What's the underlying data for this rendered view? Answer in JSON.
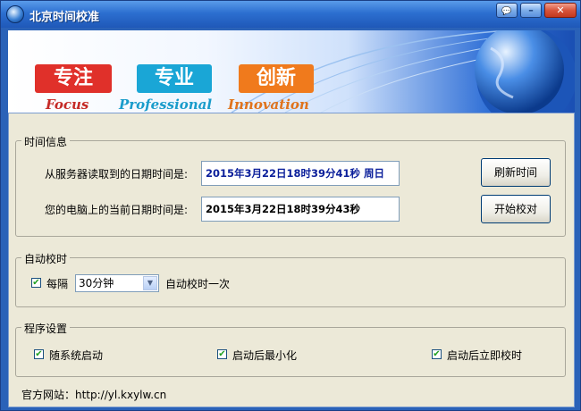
{
  "window": {
    "title": "北京时间校准"
  },
  "titlebar": {
    "help_glyph": "💬",
    "min_glyph": "–",
    "close_glyph": "✕"
  },
  "banner": {
    "brand1_cn": "专注",
    "brand1_en": "Focus",
    "brand2_cn": "专业",
    "brand2_en": "Professional",
    "brand3_cn": "创新",
    "brand3_en": "Innovation",
    "colors": {
      "red": "#e0302a",
      "cyan": "#1aa6d6",
      "orange": "#f07a1c"
    }
  },
  "time_info": {
    "group_title": "时间信息",
    "server_label": "从服务器读取到的日期时间是:",
    "server_value": "2015年3月22日18时39分41秒  周日",
    "local_label": "您的电脑上的当前日期时间是:",
    "local_value": "2015年3月22日18时39分43秒",
    "refresh_button": "刷新时间",
    "calibrate_button": "开始校对"
  },
  "auto_calibrate": {
    "group_title": "自动校时",
    "every_label": "每隔",
    "every_checked": true,
    "interval_value": "30分钟",
    "suffix_label": "自动校时一次"
  },
  "program_settings": {
    "group_title": "程序设置",
    "options": [
      {
        "label": "随系统启动",
        "checked": true
      },
      {
        "label": "启动后最小化",
        "checked": true
      },
      {
        "label": "启动后立即校时",
        "checked": true
      }
    ]
  },
  "footer": {
    "website": "官方网站：http://yl.kxylw.cn"
  }
}
